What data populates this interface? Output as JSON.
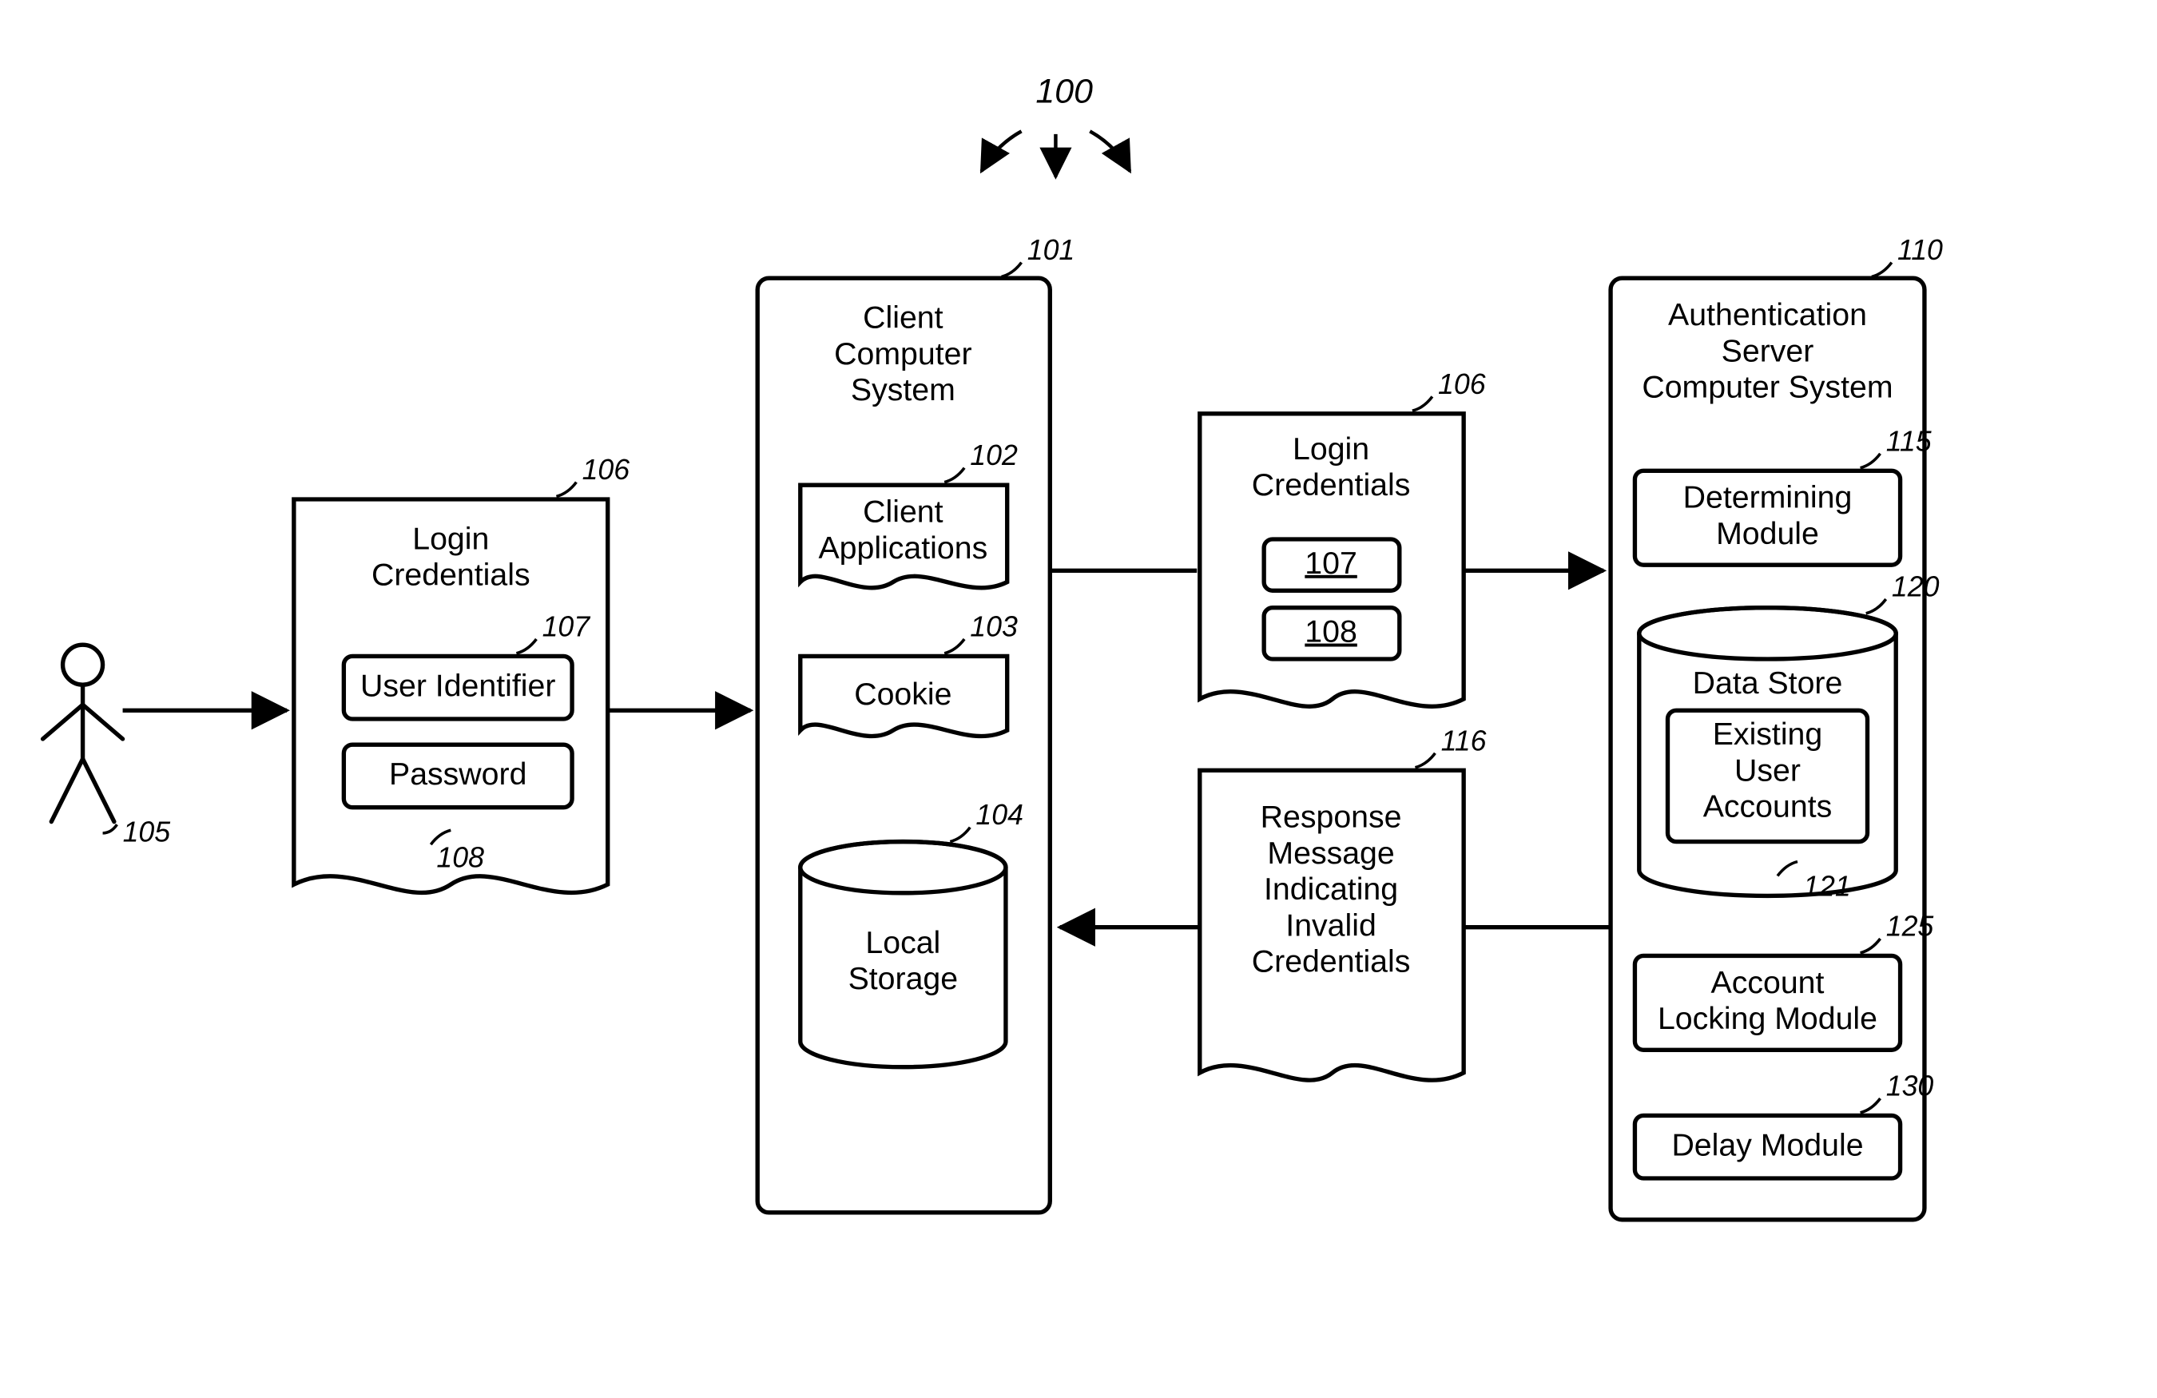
{
  "figure_ref": "100",
  "user": {
    "ref": "105"
  },
  "login_credentials_left": {
    "ref": "106",
    "title": "Login\nCredentials",
    "user_identifier": {
      "ref": "107",
      "label": "User Identifier"
    },
    "password": {
      "ref": "108",
      "label": "Password"
    }
  },
  "client_system": {
    "ref": "101",
    "title": "Client\nComputer\nSystem",
    "client_applications": {
      "ref": "102",
      "label": "Client\nApplications"
    },
    "cookie": {
      "ref": "103",
      "label": "Cookie"
    },
    "local_storage": {
      "ref": "104",
      "label": "Local\nStorage"
    }
  },
  "login_credentials_right": {
    "ref": "106",
    "title": "Login\nCredentials",
    "user_identifier_ref": "107",
    "password_ref": "108"
  },
  "response_message": {
    "ref": "116",
    "label": "Response\nMessage\nIndicating\nInvalid\nCredentials"
  },
  "auth_server": {
    "ref": "110",
    "title": "Authentication\nServer\nComputer System",
    "determining_module": {
      "ref": "115",
      "label": "Determining\nModule"
    },
    "data_store": {
      "ref": "120",
      "label": "Data Store",
      "existing_accounts": {
        "ref": "121",
        "label": "Existing\nUser\nAccounts"
      }
    },
    "account_locking_module": {
      "ref": "125",
      "label": "Account\nLocking Module"
    },
    "delay_module": {
      "ref": "130",
      "label": "Delay Module"
    }
  }
}
